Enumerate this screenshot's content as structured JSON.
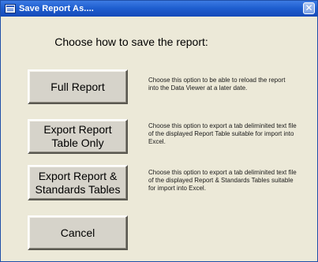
{
  "window": {
    "title": "Save Report As....",
    "close_glyph": "✕"
  },
  "heading": "Choose how to save the report:",
  "options": [
    {
      "label_lines": [
        "Full Report"
      ],
      "description": "Choose this option to be able to reload the report into the Data Viewer at a later date."
    },
    {
      "label_lines": [
        "Export Report",
        "Table Only"
      ],
      "description": "Choose this option to export a tab deliminited text file of the displayed Report Table suitable for import into Excel."
    },
    {
      "label_lines": [
        "Export Report &",
        "Standards Tables"
      ],
      "description": "Choose this option to export a tab deliminited text file of the displayed Report & Standards Tables suitable for import into Excel."
    }
  ],
  "cancel": {
    "label": "Cancel"
  },
  "icons": {
    "title_icon": "window-icon",
    "close_icon": "close-icon"
  }
}
